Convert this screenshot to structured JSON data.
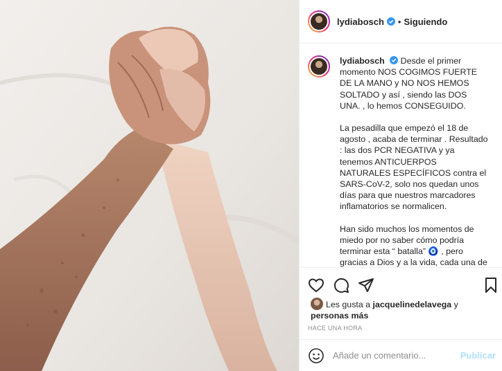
{
  "post": {
    "username": "lydiabosch",
    "follow_status": "Siguiendo",
    "separator": "•",
    "more_icon": "more-options-icon"
  },
  "caption": {
    "username": "lydiabosch",
    "p1": "Desde el primer momento NOS COGIMOS FUERTE DE LA MANO y NO NOS HEMOS SOLTADO y así , siendo las DOS UNA. , lo hemos CONSEGUIDO.",
    "p2": "La pesadilla que empezó el 18 de agosto , acaba de terminar . Resultado : las dos PCR NEGATIVA y ya tenemos ANTICUERPOS NATURALES ESPECÍFICOS contra el SARS-CoV-2, solo nos quedan unos días para que nuestros marcadores inflamatorios se normalicen.",
    "p3": "Han sido muchos los momentos de miedo por no saber cómo podría terminar esta “ batalla” 🧿 , pero gracias a Dios y a la vida, cada una de"
  },
  "likes": {
    "prefix": "Les gusta a",
    "user": "jacquelinedelavega",
    "connector": "y",
    "others": "personas más"
  },
  "timestamp": "HACE UNA HORA",
  "comment_box": {
    "placeholder": "Añade un comentario...",
    "publish_label": "Publicar"
  },
  "colors": {
    "verified": "#3897f0",
    "publish": "#b2dffc",
    "muted": "#8e8e8e"
  }
}
